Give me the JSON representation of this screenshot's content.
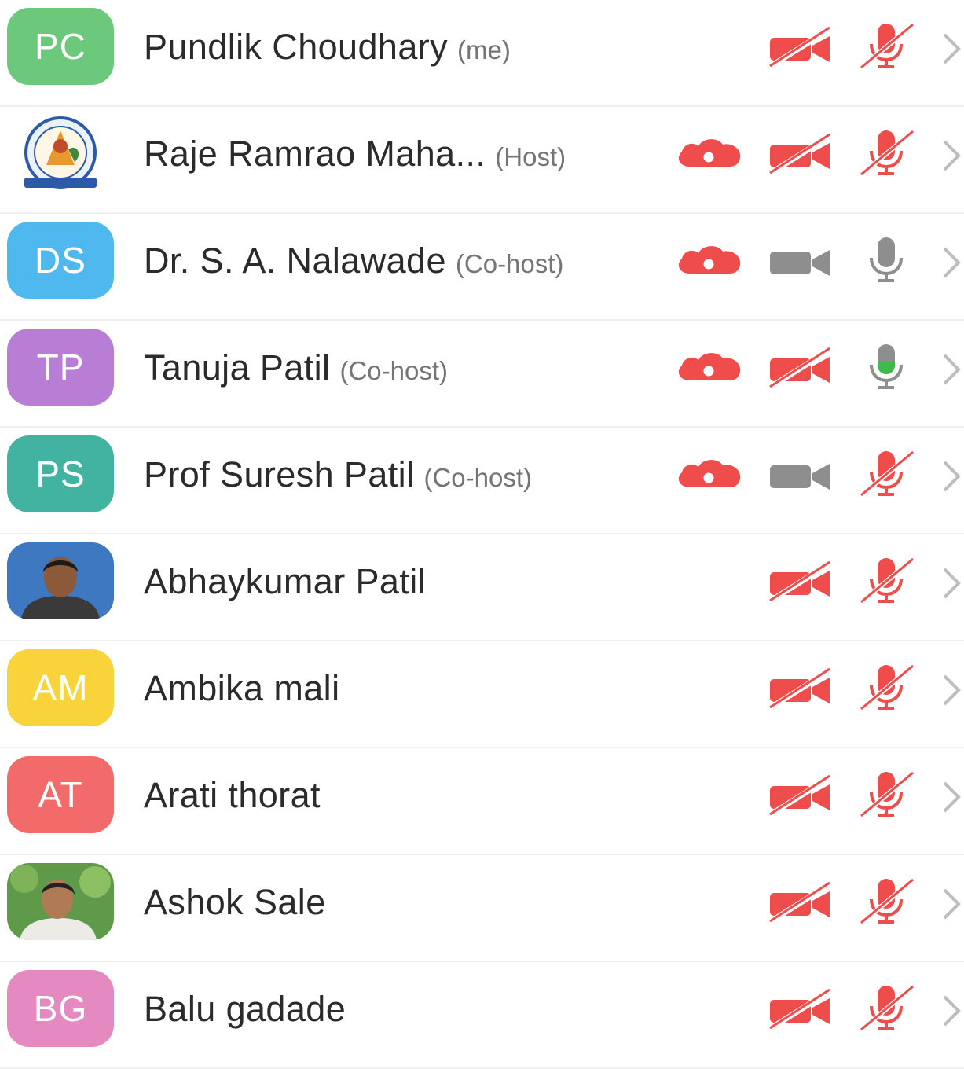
{
  "participants": [
    {
      "name": "Pundlik Choudhary",
      "role": "(me)",
      "initials": "PC",
      "avatar_color": "#6cc87a",
      "avatar_type": "initials",
      "recording": false,
      "camera": "off",
      "mic": "muted"
    },
    {
      "name": "Raje Ramrao Maha...",
      "role": "(Host)",
      "initials": "",
      "avatar_color": "#ffffff",
      "avatar_type": "college-logo",
      "recording": true,
      "camera": "off",
      "mic": "muted"
    },
    {
      "name": "Dr. S. A. Nalawade",
      "role": "(Co-host)",
      "initials": "DS",
      "avatar_color": "#4fb8ee",
      "avatar_type": "initials",
      "recording": true,
      "camera": "on",
      "mic": "on"
    },
    {
      "name": "Tanuja Patil",
      "role": "(Co-host)",
      "initials": "TP",
      "avatar_color": "#b87ed6",
      "avatar_type": "initials",
      "recording": true,
      "camera": "off",
      "mic": "speaking"
    },
    {
      "name": "Prof Suresh Patil",
      "role": "(Co-host)",
      "initials": "PS",
      "avatar_color": "#43b3a1",
      "avatar_type": "initials",
      "recording": true,
      "camera": "on",
      "mic": "muted"
    },
    {
      "name": "Abhaykumar Patil",
      "role": "",
      "initials": "",
      "avatar_color": "#3e78c0",
      "avatar_type": "photo",
      "recording": false,
      "camera": "off",
      "mic": "muted"
    },
    {
      "name": "Ambika mali",
      "role": "",
      "initials": "AM",
      "avatar_color": "#f8d43a",
      "avatar_type": "initials",
      "recording": false,
      "camera": "off",
      "mic": "muted"
    },
    {
      "name": "Arati thorat",
      "role": "",
      "initials": "AT",
      "avatar_color": "#f26a6a",
      "avatar_type": "initials",
      "recording": false,
      "camera": "off",
      "mic": "muted"
    },
    {
      "name": "Ashok Sale",
      "role": "",
      "initials": "",
      "avatar_color": "#5f9a4a",
      "avatar_type": "photo",
      "recording": false,
      "camera": "off",
      "mic": "muted"
    },
    {
      "name": "Balu gadade",
      "role": "",
      "initials": "BG",
      "avatar_color": "#e58ac0",
      "avatar_type": "initials",
      "recording": false,
      "camera": "off",
      "mic": "muted"
    }
  ],
  "icons": {
    "recording": "cloud-recording-icon",
    "camera": "video-camera-icon",
    "mic": "microphone-icon",
    "chevron": "chevron-right-icon"
  },
  "colors": {
    "muted_red": "#ef4c4c",
    "active_gray": "#8e8e8e",
    "speaking_green": "#3fba4a",
    "chevron_gray": "#bdbdbd"
  }
}
